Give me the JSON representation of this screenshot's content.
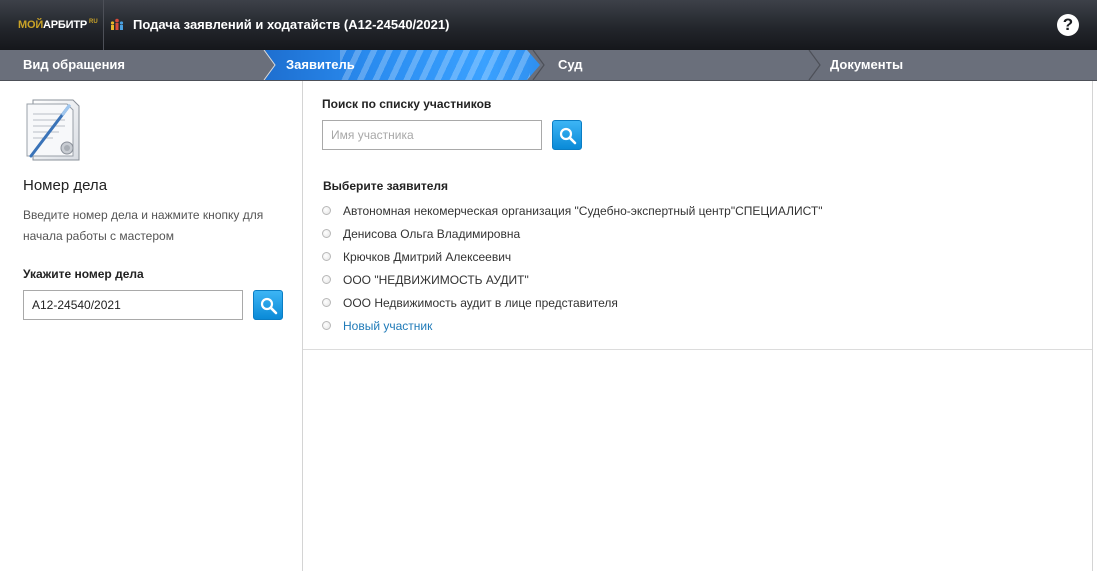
{
  "header": {
    "logo_moi": "МОЙ",
    "logo_arbitr": "АРБИТР",
    "logo_ru": "RU",
    "title": "Подача заявлений и ходатайств  (А12-24540/2021)",
    "help_label": "?"
  },
  "steps": [
    {
      "label": "Вид обращения",
      "active": false
    },
    {
      "label": "Заявитель",
      "active": true
    },
    {
      "label": "Суд",
      "active": false
    },
    {
      "label": "Документы",
      "active": false
    }
  ],
  "left": {
    "heading": "Номер дела",
    "description": "Введите номер дела и нажмите кнопку для начала работы с мастером",
    "input_label": "Укажите номер дела",
    "case_number": "А12-24540/2021"
  },
  "right": {
    "search_title": "Поиск по списку участников",
    "search_placeholder": "Имя участника",
    "choose_title": "Выберите заявителя",
    "options": [
      "Автономная некомерческая организация \"Судебно-экспертный центр\"СПЕЦИАЛИСТ\"",
      "Денисова Ольга Владимировна",
      "Крючков Дмитрий Алексеевич",
      "ООО \"НЕДВИЖИМОСТЬ АУДИТ\"",
      "ООО Недвижимость аудит в лице представителя"
    ],
    "new_participant": "Новый участник"
  },
  "colors": {
    "header_bg": "#23262c",
    "steps_bg": "#6a6f7b",
    "active_step": "#2a8cf0",
    "logo_gold": "#c9a227",
    "link": "#1f7ab8",
    "search_button": "#0a8ad7"
  }
}
